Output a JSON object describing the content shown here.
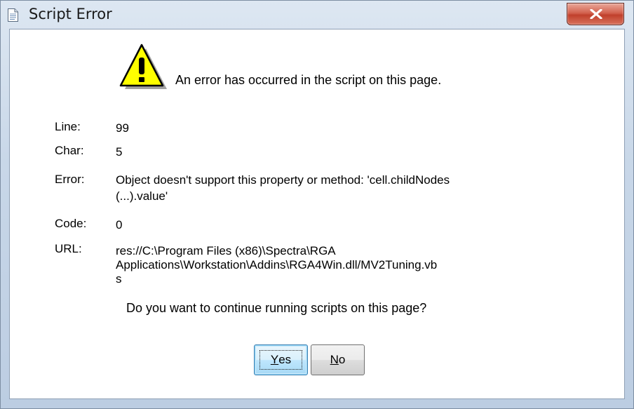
{
  "window": {
    "title": "Script Error"
  },
  "dialog": {
    "header_message": "An error has occurred in the script on this page.",
    "fields": {
      "line": {
        "label": "Line:",
        "value": "99"
      },
      "char": {
        "label": "Char:",
        "value": "5"
      },
      "error": {
        "label": "Error:",
        "value_line1": "Object doesn't support this property or method: 'cell.childNodes",
        "value_line2": "(...).value'"
      },
      "code": {
        "label": "Code:",
        "value": "0"
      },
      "url": {
        "label": "URL:",
        "value_line1": "res://C:\\Program Files (x86)\\Spectra\\RGA",
        "value_line2": "Applications\\Workstation\\Addins\\RGA4Win.dll/MV2Tuning.vb",
        "value_line3": "s"
      }
    },
    "question": "Do you want to continue running scripts on this page?",
    "buttons": {
      "yes_mnemonic": "Y",
      "yes_rest": "es",
      "no_mnemonic": "N",
      "no_rest": "o"
    }
  },
  "icons": {
    "title_icon": "document-icon",
    "warning_icon": "warning-icon",
    "close_icon": "close-icon"
  },
  "colors": {
    "frame": "#c8d7e8",
    "close_button": "#c0402c",
    "warning_fill": "#ffff00"
  }
}
